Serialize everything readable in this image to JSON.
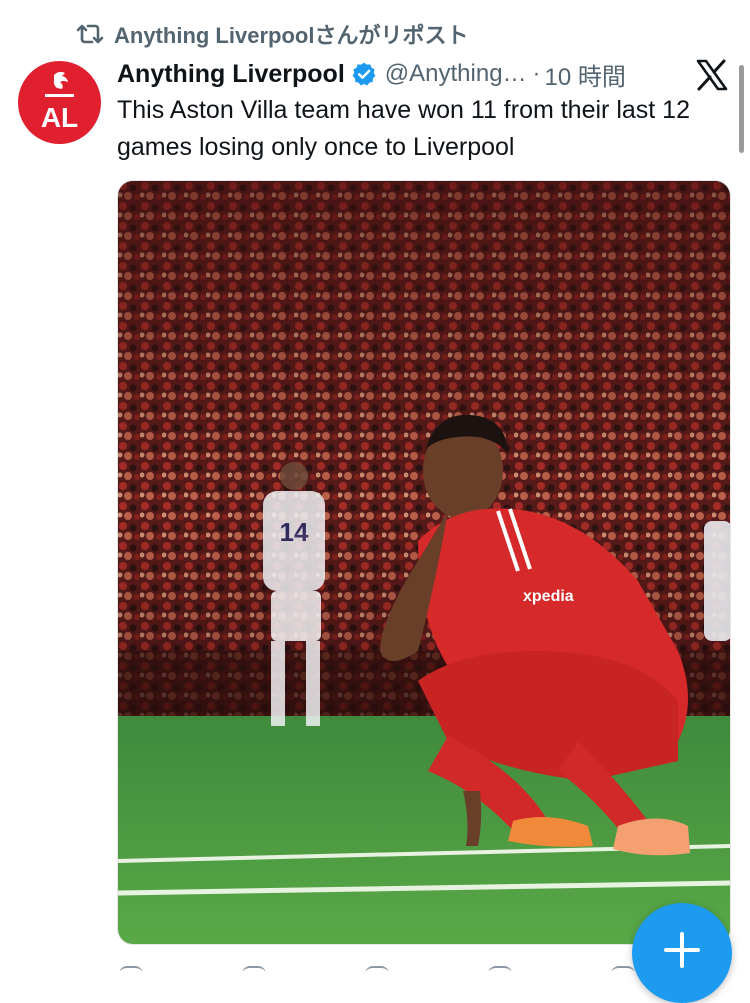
{
  "repost": {
    "icon": "repost-icon",
    "label": "Anything Liverpoolさんがリポスト"
  },
  "tweet": {
    "avatar_icon": "anything-liverpool-logo",
    "avatar_letters": "AL",
    "display_name": "Anything Liverpool",
    "verified_icon": "verified-badge-icon",
    "handle": "@Anything…",
    "separator": "·",
    "time": "10 時間",
    "text": "This Aston Villa team have won 11 from their last 12 games losing only once to Liverpool",
    "media": {
      "description_icon": "photo-footballer-crouching",
      "shirt_number": "14"
    }
  },
  "actions": {
    "icons": [
      "reply-icon",
      "repost-icon",
      "like-icon",
      "views-icon",
      "bookmark-icon"
    ]
  },
  "fab": {
    "icon": "plus-icon"
  },
  "colors": {
    "accent": "#1d9bf0",
    "avatar": "#e0202e",
    "secondary_text": "#536471"
  }
}
